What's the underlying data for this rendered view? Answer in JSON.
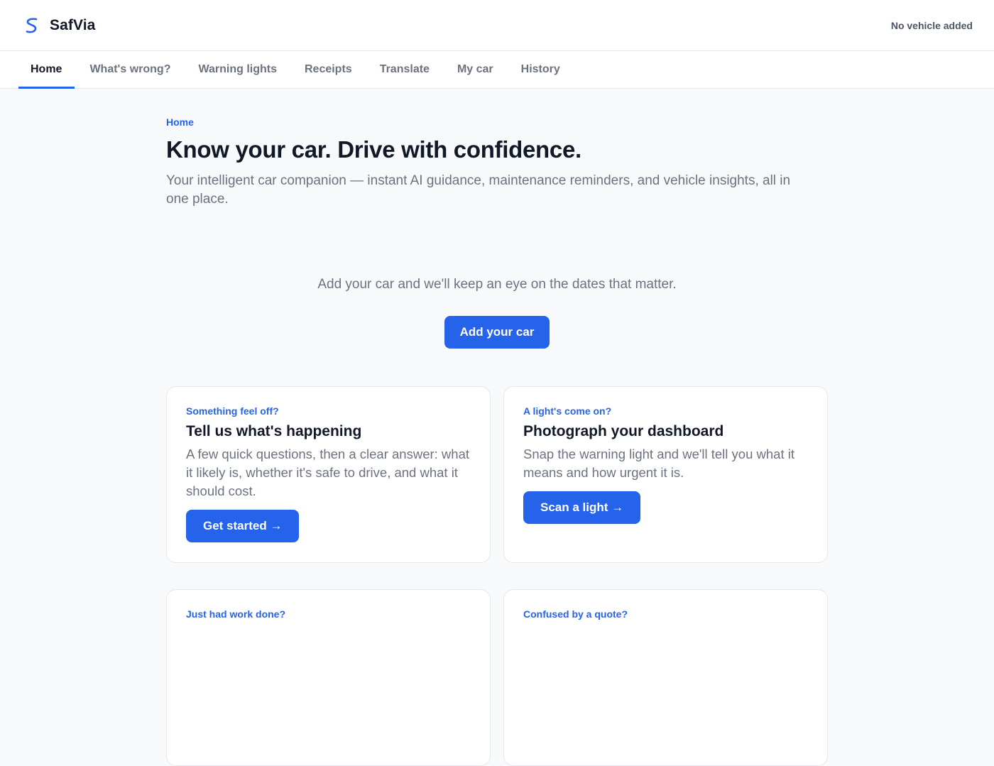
{
  "app": {
    "name": "SafVia",
    "vehicle_status": "No vehicle added",
    "accent": "#2563eb"
  },
  "nav": {
    "items": [
      {
        "label": "Home",
        "active": true
      },
      {
        "label": "What's wrong?"
      },
      {
        "label": "Warning lights"
      },
      {
        "label": "Receipts"
      },
      {
        "label": "Translate"
      },
      {
        "label": "My car"
      },
      {
        "label": "History"
      }
    ]
  },
  "hero": {
    "breadcrumb": "Home",
    "title": "Know your car. Drive with confidence.",
    "subtitle": "Your intelligent car companion — instant AI guidance, maintenance reminders, and vehicle insights, all in one place."
  },
  "cta": {
    "text": "Add your car and we'll keep an eye on the dates that matter.",
    "button": "Add your car"
  },
  "cards": [
    {
      "kicker": "Something feel off?",
      "title": "Tell us what's happening",
      "desc": "A few quick questions, then a clear answer: what it likely is, whether it's safe to drive, and what it should cost.",
      "button": "Get started →"
    },
    {
      "kicker": "A light's come on?",
      "title": "Photograph your dashboard",
      "desc": "Snap the warning light and we'll tell you what it means and how urgent it is.",
      "button": "Scan a light →"
    },
    {
      "kicker": "Just had work done?"
    },
    {
      "kicker": "Confused by a quote?"
    }
  ]
}
